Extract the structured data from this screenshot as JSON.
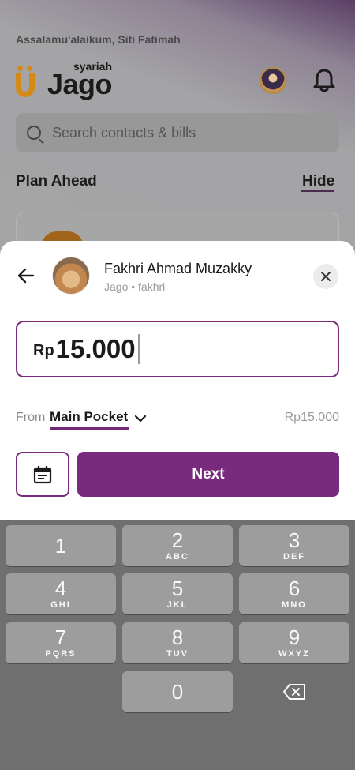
{
  "background": {
    "greeting": "Assalamu'alaikum, Siti Fatimah",
    "brand_sub": "syariah",
    "brand_main": "Jago",
    "search_placeholder": "Search contacts & bills",
    "section_title": "Plan Ahead",
    "hide_label": "Hide"
  },
  "sheet": {
    "contact_name": "Fakhri Ahmad Muzakky",
    "contact_sub": "Jago • fakhri",
    "amount_currency": "Rp",
    "amount_value": "15.000",
    "from_label": "From",
    "pocket_name": "Main Pocket",
    "pocket_balance": "Rp15.000",
    "next_label": "Next"
  },
  "keypad": {
    "keys": [
      {
        "num": "1",
        "letters": ""
      },
      {
        "num": "2",
        "letters": "ABC"
      },
      {
        "num": "3",
        "letters": "DEF"
      },
      {
        "num": "4",
        "letters": "GHI"
      },
      {
        "num": "5",
        "letters": "JKL"
      },
      {
        "num": "6",
        "letters": "MNO"
      },
      {
        "num": "7",
        "letters": "PQRS"
      },
      {
        "num": "8",
        "letters": "TUV"
      },
      {
        "num": "9",
        "letters": "WXYZ"
      },
      {
        "num": "0",
        "letters": ""
      }
    ]
  },
  "colors": {
    "accent": "#782a7c",
    "brand_orange": "#d48a16"
  },
  "icons": {
    "back": "arrow-left-icon",
    "close": "close-icon",
    "calendar": "calendar-icon",
    "chevron": "chevron-down-icon",
    "backspace": "backspace-icon",
    "bell": "bell-icon",
    "search": "search-icon"
  }
}
